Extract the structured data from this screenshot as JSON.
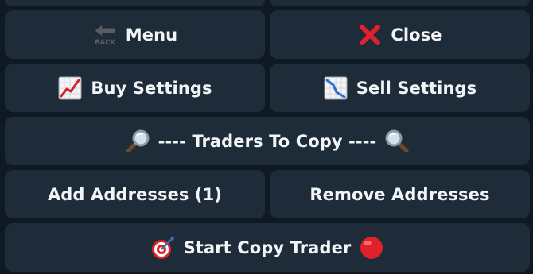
{
  "buttons": {
    "menu": {
      "label": "Menu",
      "icon": "back-arrow-icon",
      "icon_text": "BACK"
    },
    "close": {
      "label": "Close",
      "icon": "red-x-icon"
    },
    "buy_settings": {
      "label": "Buy Settings",
      "icon": "chart-increasing-icon"
    },
    "sell_settings": {
      "label": "Sell Settings",
      "icon": "chart-decreasing-icon"
    },
    "traders_to_copy": {
      "label": "---- Traders To Copy ----",
      "icon_left": "magnifier-left-icon",
      "icon_right": "magnifier-right-icon"
    },
    "add_addresses": {
      "label": "Add Addresses (1)"
    },
    "remove_addresses": {
      "label": "Remove Addresses"
    },
    "start_copy_trader": {
      "label": "Start Copy Trader",
      "icon_left": "direct-hit-target-icon",
      "icon_right": "red-circle-icon"
    }
  },
  "colors": {
    "background": "#0f1923",
    "button": "#1e2b38",
    "text": "#f2f5f8",
    "red": "#e0202a"
  }
}
